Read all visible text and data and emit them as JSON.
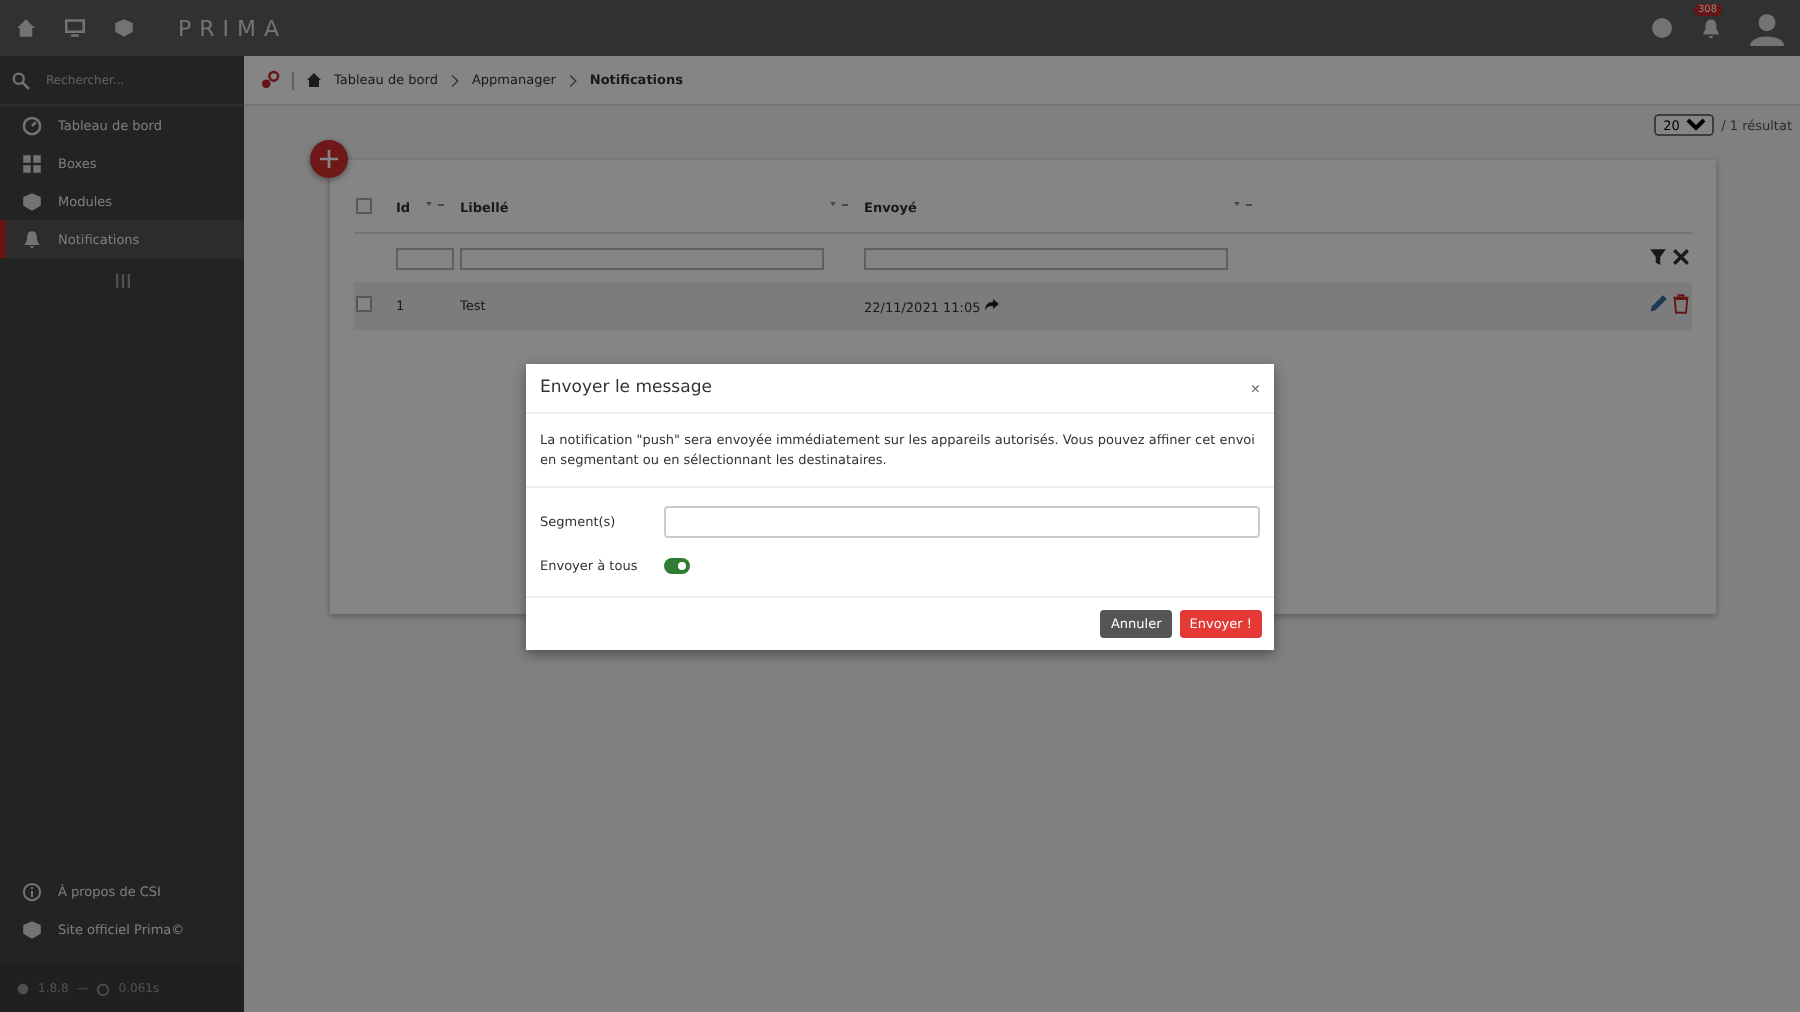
{
  "topbar": {
    "logo": "PRIMA",
    "notifications_badge": "308"
  },
  "sidebar": {
    "search": {
      "placeholder": "Rechercher..."
    },
    "items": [
      {
        "label": "Tableau de bord",
        "selected": false
      },
      {
        "label": "Boxes",
        "selected": false
      },
      {
        "label": "Modules",
        "selected": false
      },
      {
        "label": "Notifications",
        "selected": true
      }
    ],
    "footer_links": [
      {
        "label": "À propos de CSI"
      },
      {
        "label": "Site officiel Prima©"
      }
    ],
    "version": "1.8.8",
    "separator": "—",
    "time": "0.061s"
  },
  "breadcrumb": [
    "Tableau de bord",
    "Appmanager",
    "Notifications"
  ],
  "pager": {
    "page_size": "20",
    "results": "/ 1 résultat"
  },
  "table": {
    "select_all_checked": false,
    "columns": [
      "Id",
      "Libellé",
      "Envoyé"
    ],
    "rows": [
      {
        "cells": [
          "1",
          "Test",
          "22/11/2021 11:05"
        ],
        "checked": false
      }
    ]
  },
  "modal": {
    "title": "Envoyer le message",
    "close": "×",
    "text": "La notification \"push\" sera envoyée immédiatement sur les appareils autorisés. Vous pouvez affiner cet envoi en segmentant ou en sélectionnant les destinataires.",
    "fields": [
      {
        "kind": "text",
        "label": "Segment(s)"
      },
      {
        "kind": "toggle",
        "label": "Envoyer à tous",
        "on": true
      }
    ],
    "buttons": [
      {
        "label": "Annuler",
        "kind": "secondary"
      },
      {
        "label": "Envoyer !",
        "kind": "primary"
      }
    ]
  }
}
